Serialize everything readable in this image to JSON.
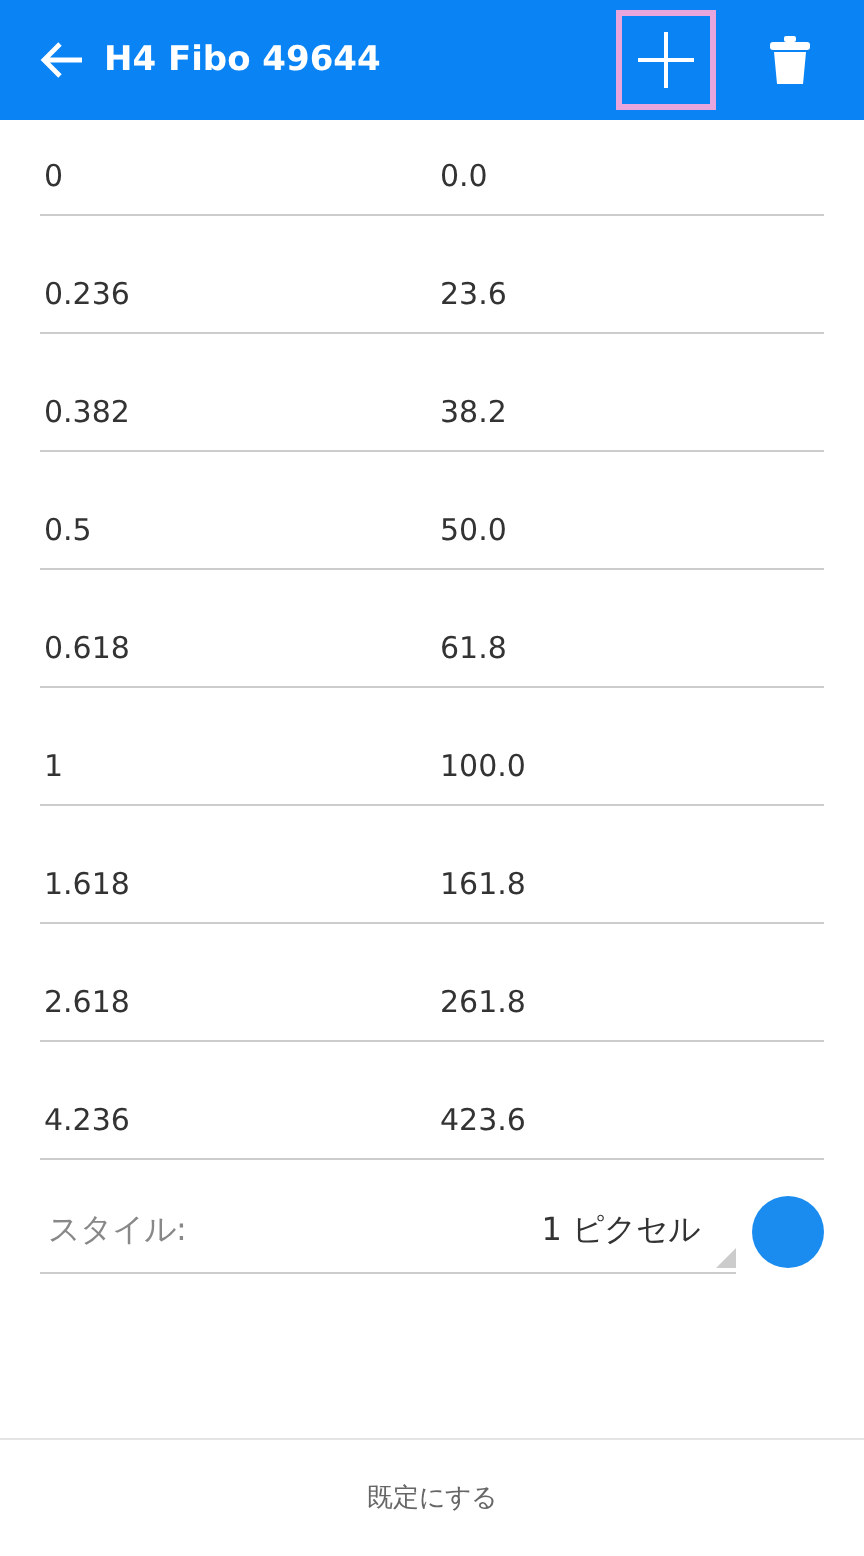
{
  "header": {
    "title": "H4 Fibo 49644",
    "add_highlighted": true
  },
  "levels": [
    {
      "value": "0",
      "description": "0.0"
    },
    {
      "value": "0.236",
      "description": "23.6"
    },
    {
      "value": "0.382",
      "description": "38.2"
    },
    {
      "value": "0.5",
      "description": "50.0"
    },
    {
      "value": "0.618",
      "description": "61.8"
    },
    {
      "value": "1",
      "description": "100.0"
    },
    {
      "value": "1.618",
      "description": "161.8"
    },
    {
      "value": "2.618",
      "description": "261.8"
    },
    {
      "value": "4.236",
      "description": "423.6"
    }
  ],
  "style": {
    "label": "スタイル:",
    "value": "1 ピクセル",
    "color": "#1a8cf0"
  },
  "footer": {
    "button": "既定にする"
  }
}
